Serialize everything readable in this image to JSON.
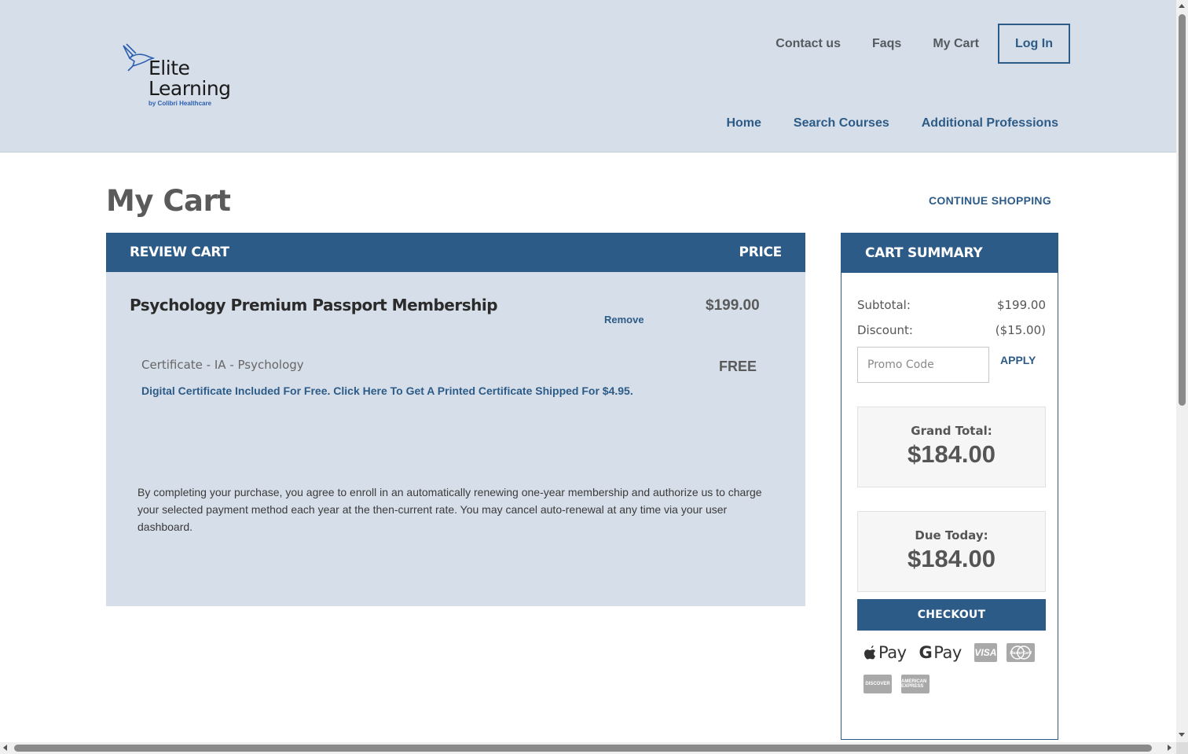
{
  "header": {
    "logo": {
      "line1": "Elite",
      "line2": "Learning",
      "byline": "by Colibri Healthcare"
    },
    "top_nav": [
      {
        "label": "Contact us"
      },
      {
        "label": "Faqs"
      },
      {
        "label": "My Cart"
      }
    ],
    "login_label": "Log In",
    "main_nav": [
      {
        "label": "Home"
      },
      {
        "label": "Search Courses"
      },
      {
        "label": "Additional Professions"
      }
    ]
  },
  "page": {
    "title": "My Cart",
    "continue_shopping": "CONTINUE SHOPPING"
  },
  "review_cart": {
    "heading": "REVIEW CART",
    "price_heading": "PRICE",
    "item": {
      "name": "Psychology Premium Passport Membership",
      "remove_label": "Remove",
      "price": "$199.00"
    },
    "certificate": {
      "name": "Certificate - IA - Psychology",
      "price": "FREE",
      "link": "Digital Certificate Included For Free. Click Here To Get A Printed Certificate Shipped For $4.95."
    },
    "terms": "By completing your purchase, you agree to enroll in an automatically renewing one-year membership and authorize us to charge your selected payment method each year at the then-current rate. You may cancel auto-renewal at any time via your user dashboard."
  },
  "summary": {
    "heading": "CART SUMMARY",
    "subtotal_label": "Subtotal:",
    "subtotal_value": "$199.00",
    "discount_label": "Discount:",
    "discount_value": "($15.00)",
    "promo_placeholder": "Promo Code",
    "apply_label": "APPLY",
    "grand_total_label": "Grand Total:",
    "grand_total_value": "$184.00",
    "due_today_label": "Due Today:",
    "due_today_value": "$184.00",
    "checkout_label": "CHECKOUT",
    "payment_methods": {
      "apple_pay": "Pay",
      "google_pay": "Pay",
      "visa": "VISA",
      "mastercard": "MasterCard",
      "discover": "DISCOVER",
      "amex": "AMERICAN EXPRESS"
    }
  },
  "colors": {
    "brand_blue": "#2d5b87",
    "header_bg": "#d6dfe9"
  },
  "icons": [
    "hummingbird-logo-icon",
    "apple-icon",
    "google-g-icon",
    "visa-card-icon",
    "mastercard-card-icon",
    "discover-card-icon",
    "amex-card-icon"
  ]
}
